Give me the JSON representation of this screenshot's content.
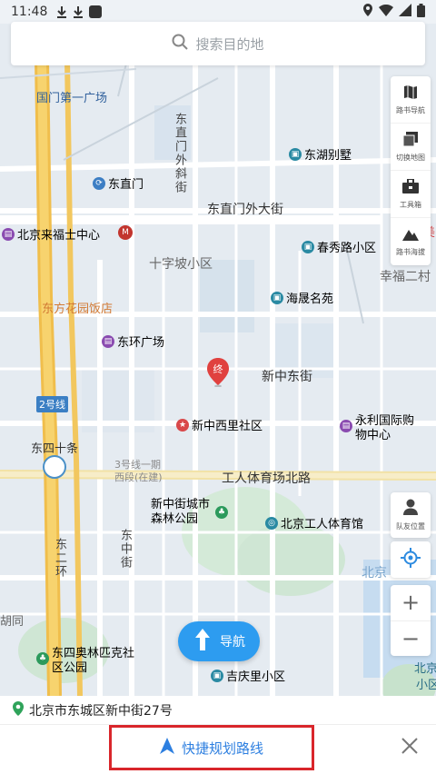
{
  "status_bar": {
    "time": "11:48"
  },
  "search": {
    "placeholder": "搜索目的地"
  },
  "tools": [
    {
      "label": "路书导航",
      "icon": "map-book-icon"
    },
    {
      "label": "切换地图",
      "icon": "layers-icon"
    },
    {
      "label": "工具箱",
      "icon": "toolbox-icon"
    },
    {
      "label": "路书海拔",
      "icon": "mountain-icon"
    }
  ],
  "friend_location": {
    "label": "队友位置",
    "icon": "person-icon"
  },
  "zoom": {
    "in": "+",
    "out": "−"
  },
  "map_labels": {
    "guomen": "国门第一广场",
    "dongzhimen": "东直门",
    "dongzhimenwaixiejie": "东直门外斜街",
    "donghubieshu": "东湖别墅",
    "dongzhimenwaidajie": "东直门外大街",
    "laifushi": "北京来福士中心",
    "chunxiu": "春秀路小区",
    "xingfuer": "幸福二村",
    "shizipo": "十字坡小区",
    "haisheng": "海晟名苑",
    "dongfang": "东方花园饭店",
    "donghuan": "东环广场",
    "xinzhongdongjie": "新中东街",
    "xinzhongxili": "新中西里社区",
    "line2": "2号线",
    "yongli": "永利国际购物中心",
    "dongsishitiao": "东四十条",
    "line3": "3号线一期",
    "xiduan": "西段(在建)",
    "gongti_beilu": "工人体育场北路",
    "xinzhongjie_park": "新中街城市森林公园",
    "gongti": "北京工人体育馆",
    "dongzhongjie": "东中街",
    "dongerhuan": "东二环",
    "beijing_right": "北京",
    "hutong": "胡同",
    "aolinpike": "东四奥林匹克社区公园",
    "jiqingli": "吉庆里小区",
    "beijing_br": "北京",
    "xiaoqu": "小区",
    "dest_marker": "终",
    "mei": "美"
  },
  "nav_button": {
    "label": "导航"
  },
  "address": {
    "text": "北京市东城区新中街27号"
  },
  "route_button": {
    "label": "快捷规划路线"
  },
  "colors": {
    "accent": "#2d9cf0",
    "highlight_border": "#d9262b",
    "road_major": "#f5c95a"
  }
}
